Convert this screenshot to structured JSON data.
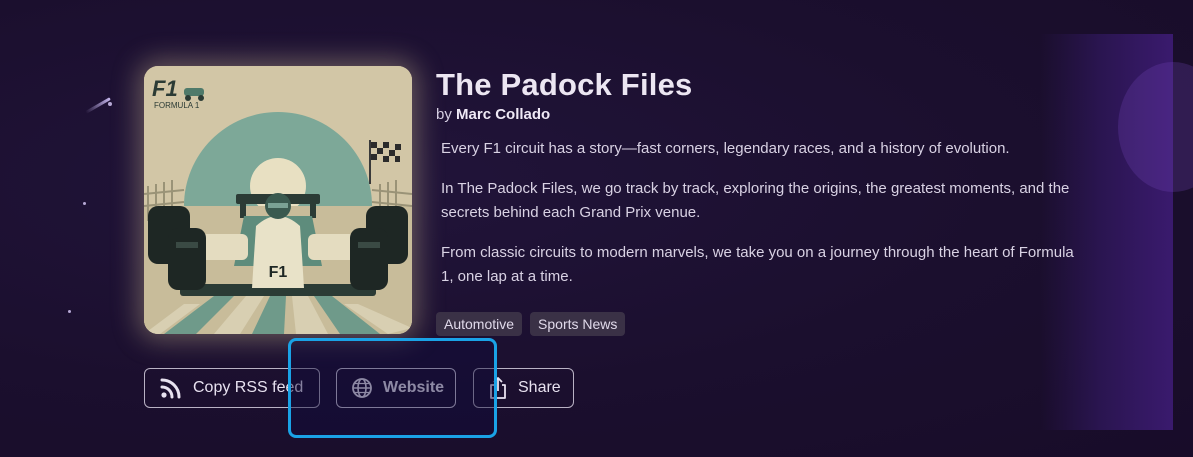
{
  "podcast": {
    "title": "The Padock Files",
    "by_prefix": "by",
    "author": "Marc Collado",
    "description": [
      "Every F1 circuit has a story—fast corners, legendary races, and a history of evolution.",
      "In The Padock Files, we go track by track, exploring the origins, the greatest moments, and the secrets behind each Grand Prix venue.",
      "From classic circuits to modern marvels, we take you on a journey through the heart of Formula 1, one lap at a time."
    ],
    "tags": [
      "Automotive",
      "Sports News"
    ]
  },
  "cover": {
    "logo_text": "F1",
    "logo_subtext": "FORMULA 1",
    "car_number": "F1"
  },
  "actions": {
    "rss_label": "Copy RSS feed",
    "website_label": "Website",
    "share_label": "Share"
  },
  "icons": {
    "rss": "rss-icon",
    "website": "globe-icon",
    "share": "share-icon"
  },
  "colors": {
    "background": "#1b0f2e",
    "focus_ring": "#1aa2e6",
    "tag_bg": "#3a3146"
  }
}
